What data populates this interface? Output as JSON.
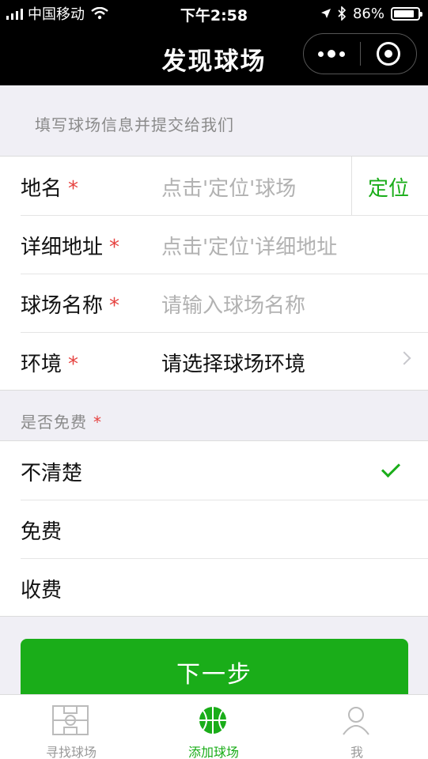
{
  "status_bar": {
    "carrier": "中国移动",
    "time": "下午2:58",
    "battery": "86%",
    "battery_level": 0.86
  },
  "nav": {
    "title": "发现球场"
  },
  "form": {
    "hint": "填写球场信息并提交给我们",
    "required_mark": "*",
    "fields": [
      {
        "label": "地名",
        "placeholder": "点击'定位'球场",
        "action": "定位"
      },
      {
        "label": "详细地址",
        "placeholder": "点击'定位'详细地址"
      },
      {
        "label": "球场名称",
        "placeholder": "请输入球场名称"
      },
      {
        "label": "环境",
        "value": "请选择球场环境"
      }
    ]
  },
  "free_section": {
    "title": "是否免费",
    "options": [
      {
        "label": "不清楚",
        "selected": true
      },
      {
        "label": "免费",
        "selected": false
      },
      {
        "label": "收费",
        "selected": false
      }
    ]
  },
  "next_button": "下一步",
  "tabbar": {
    "tabs": [
      {
        "label": "寻找球场",
        "icon": "court-icon",
        "active": false
      },
      {
        "label": "添加球场",
        "icon": "basketball-icon",
        "active": true
      },
      {
        "label": "我",
        "icon": "person-icon",
        "active": false
      }
    ]
  },
  "colors": {
    "accent": "#1aad19",
    "required": "#e64340",
    "header": "#000000"
  }
}
